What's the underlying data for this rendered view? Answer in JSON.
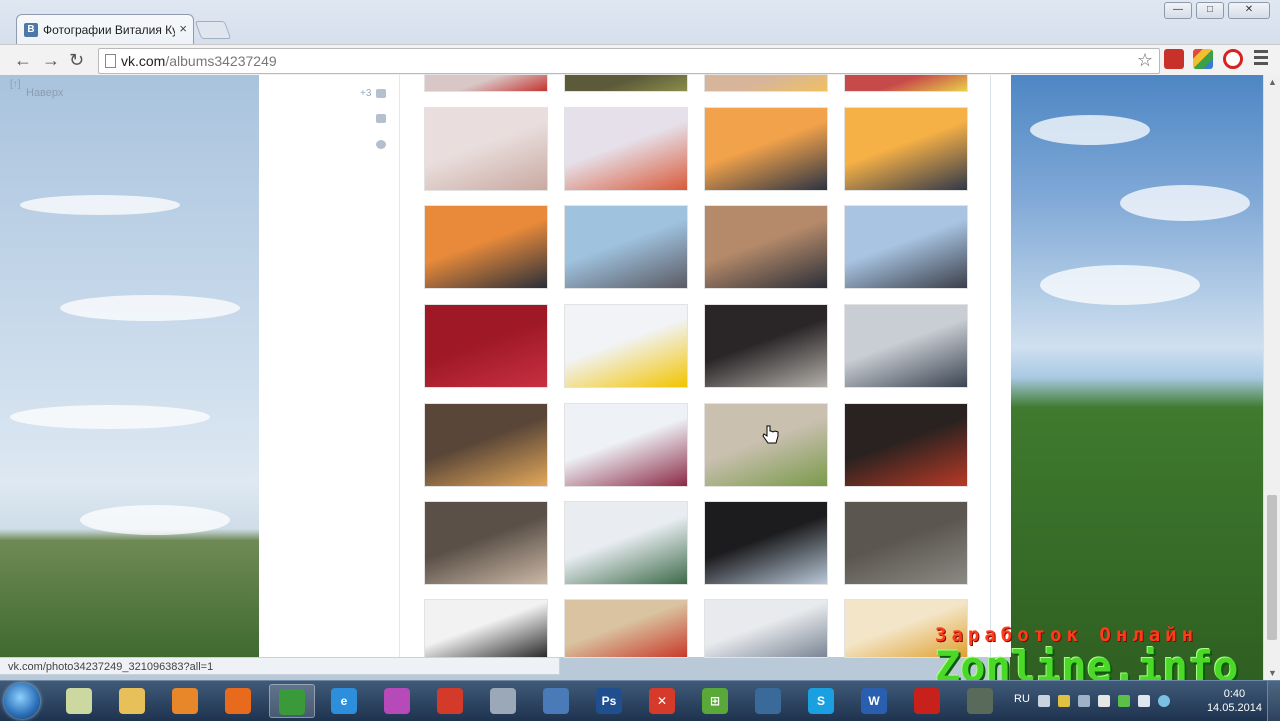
{
  "browser": {
    "tab_title": "Фотографии Виталия Ку",
    "tab_favicon": "B",
    "tab_close": "×",
    "url_host": "vk.com",
    "url_path": "/albums34237249",
    "window_buttons": [
      "—",
      "□",
      "✕"
    ]
  },
  "page": {
    "up_link": "Наверх",
    "up_corner": "[↑]",
    "side_count": "+3",
    "status_url": "vk.com/photo34237249_321096383?all=1"
  },
  "photos": [
    {
      "c1": "#d9c7c7",
      "c2": "#c4332f"
    },
    {
      "c1": "#5b5a3a",
      "c2": "#8a8d4a"
    },
    {
      "c1": "#d7b59a",
      "c2": "#f0c060"
    },
    {
      "c1": "#c74a4a",
      "c2": "#e9d04a"
    },
    {
      "c1": "#e9dedd",
      "c2": "#c9a9a0"
    },
    {
      "c1": "#e6e0ea",
      "c2": "#d85a3a"
    },
    {
      "c1": "#f2a24a",
      "c2": "#2b3344"
    },
    {
      "c1": "#f5b046",
      "c2": "#30384a"
    },
    {
      "c1": "#e88a3a",
      "c2": "#2a2f3a"
    },
    {
      "c1": "#9fc2df",
      "c2": "#5a5a62"
    },
    {
      "c1": "#b58a6a",
      "c2": "#2b2f38"
    },
    {
      "c1": "#a8c4e2",
      "c2": "#3b3f4a"
    },
    {
      "c1": "#9e1826",
      "c2": "#c83042"
    },
    {
      "c1": "#f1f3f6",
      "c2": "#f2c400"
    },
    {
      "c1": "#2a2628",
      "c2": "#b3b0ab"
    },
    {
      "c1": "#c9ced4",
      "c2": "#3b4452"
    },
    {
      "c1": "#5a4638",
      "c2": "#e3a85a"
    },
    {
      "c1": "#eef2f6",
      "c2": "#8a2a46"
    },
    {
      "c1": "#c9c0b0",
      "c2": "#7a9a4a"
    },
    {
      "c1": "#2a2220",
      "c2": "#b83a26"
    },
    {
      "c1": "#5a5048",
      "c2": "#cbb8a6"
    },
    {
      "c1": "#e9edf2",
      "c2": "#3d6a4a"
    },
    {
      "c1": "#1c1c1e",
      "c2": "#b9c8d8"
    },
    {
      "c1": "#5b5650",
      "c2": "#8c8a84"
    },
    {
      "c1": "#f2f2f2",
      "c2": "#2a2a2a"
    },
    {
      "c1": "#d9c3a0",
      "c2": "#c83a2a"
    },
    {
      "c1": "#e8eaed",
      "c2": "#7a8594"
    },
    {
      "c1": "#f3e6c8",
      "c2": "#e0a030"
    }
  ],
  "watermark": {
    "line1": "Заработок Онлайн",
    "line2": "Zonline.info"
  },
  "taskbar": {
    "apps": [
      {
        "icon": "notes-icon",
        "color": "#cbd9a0",
        "label": ""
      },
      {
        "icon": "folder-icon",
        "color": "#e8c05a",
        "label": ""
      },
      {
        "icon": "media-player-icon",
        "color": "#e8862a",
        "label": ""
      },
      {
        "icon": "firefox-icon",
        "color": "#e86a1c",
        "label": ""
      },
      {
        "icon": "chrome-icon",
        "color": "#3a9a3a",
        "label": ""
      },
      {
        "icon": "ie-icon",
        "color": "#2d8fdc",
        "label": "e"
      },
      {
        "icon": "picasa-icon",
        "color": "#b54ab8",
        "label": ""
      },
      {
        "icon": "app-icon",
        "color": "#d43a2a",
        "label": ""
      },
      {
        "icon": "webcam-icon",
        "color": "#9aa8b8",
        "label": ""
      },
      {
        "icon": "book-icon",
        "color": "#4a7ab8",
        "label": ""
      },
      {
        "icon": "photoshop-icon",
        "color": "#1f4f8f",
        "label": "Ps"
      },
      {
        "icon": "xmind-icon",
        "color": "#d63a2a",
        "label": "✕"
      },
      {
        "icon": "calc-icon",
        "color": "#5aa83a",
        "label": "⊞"
      },
      {
        "icon": "network-icon",
        "color": "#3a6a9a",
        "label": ""
      },
      {
        "icon": "skype-icon",
        "color": "#1aa0e0",
        "label": "S"
      },
      {
        "icon": "word-icon",
        "color": "#2a5fb0",
        "label": "W"
      },
      {
        "icon": "pdf-icon",
        "color": "#c8201a",
        "label": ""
      },
      {
        "icon": "pen-icon",
        "color": "#5a6a5a",
        "label": ""
      }
    ],
    "language": "RU",
    "time": "0:40",
    "date": "14.05.2014"
  }
}
